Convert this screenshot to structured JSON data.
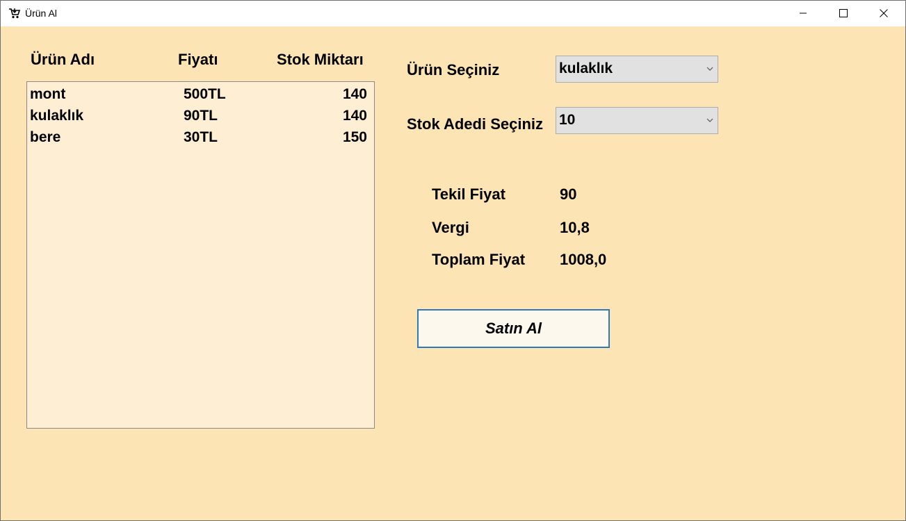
{
  "window": {
    "title": "Ürün Al",
    "icon": "cart-icon"
  },
  "product_list": {
    "headers": [
      "Ürün Adı",
      "Fiyatı",
      "Stok Miktarı"
    ],
    "rows": [
      {
        "name": "mont",
        "price": "500TL",
        "stock": "140"
      },
      {
        "name": "kulaklık",
        "price": "90TL",
        "stock": "140"
      },
      {
        "name": "bere",
        "price": "30TL",
        "stock": "150"
      }
    ]
  },
  "form": {
    "product_label": "Ürün Seçiniz",
    "product_value": "kulaklık",
    "quantity_label": "Stok Adedi Seçiniz",
    "quantity_value": "10"
  },
  "summary": {
    "unit_price_label": "Tekil Fiyat",
    "unit_price_value": "90",
    "tax_label": "Vergi",
    "tax_value": "10,8",
    "total_label": "Toplam Fiyat",
    "total_value": "1008,0"
  },
  "actions": {
    "buy_label": "Satın Al"
  },
  "colors": {
    "background": "#fde4b4",
    "listbox": "#fdeed4",
    "button_border": "#2f78c1"
  }
}
